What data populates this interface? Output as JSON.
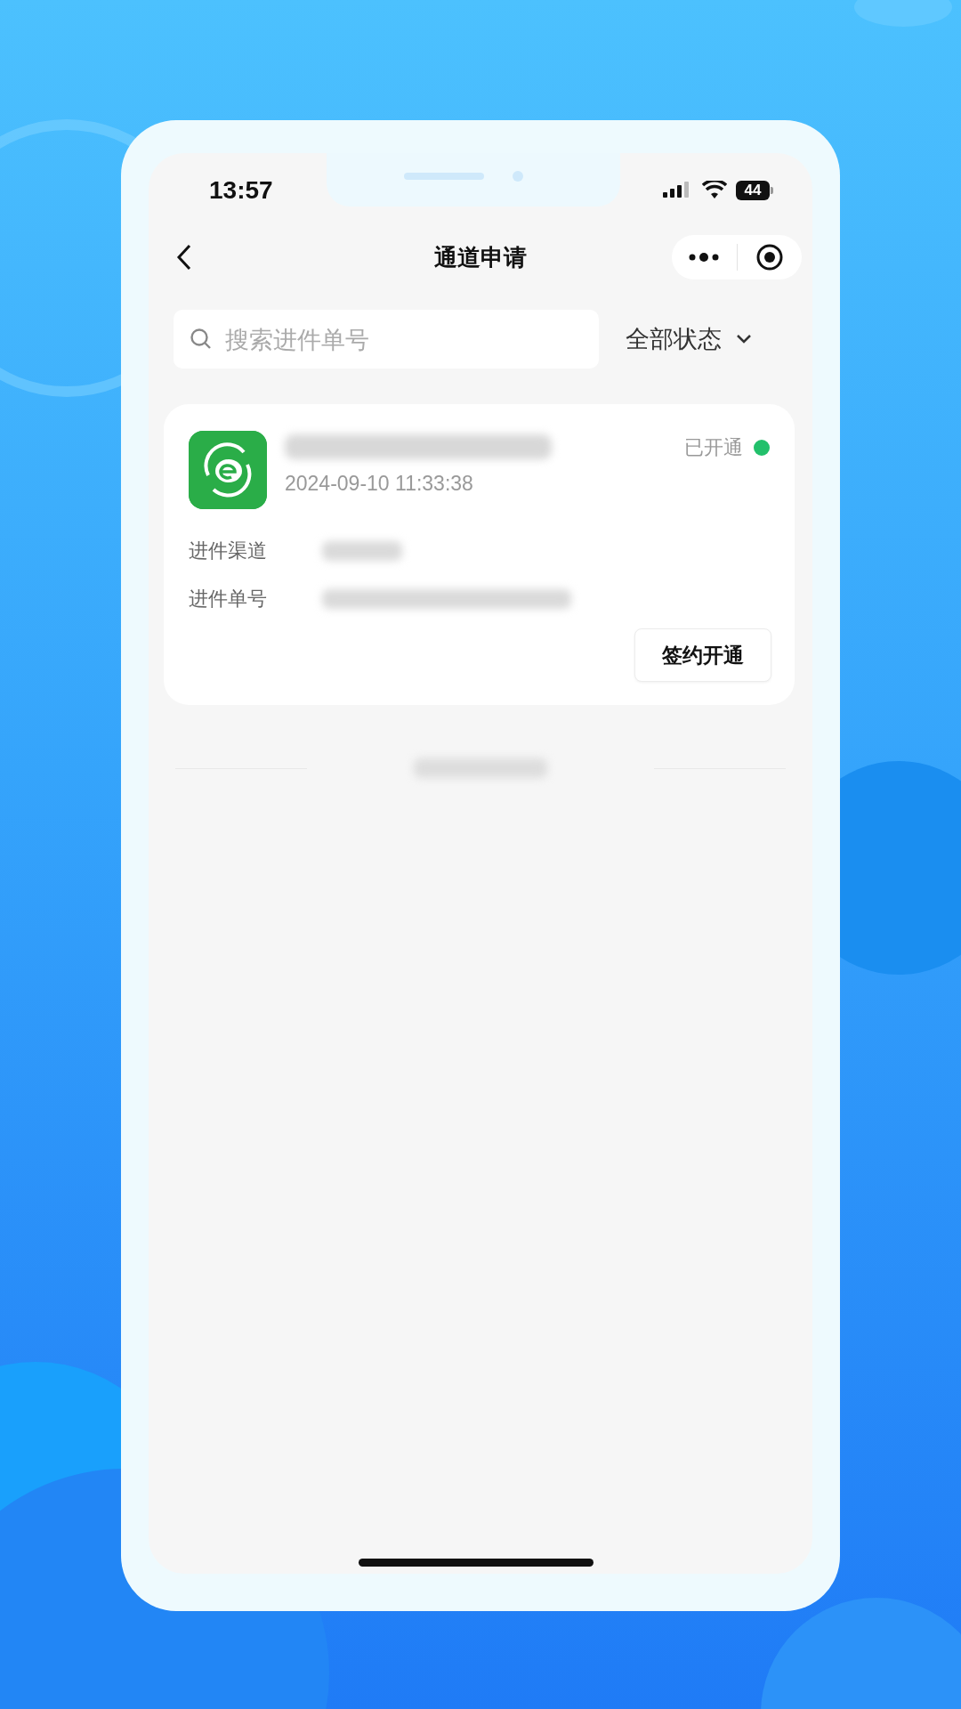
{
  "status_bar": {
    "time": "13:57",
    "battery": "44"
  },
  "nav": {
    "title": "通道申请"
  },
  "search": {
    "placeholder": "搜索进件单号"
  },
  "filter": {
    "label": "全部状态"
  },
  "records": [
    {
      "date": "2024-09-10 11:33:38",
      "status": "已开通",
      "color": "#22c06b",
      "fields": [
        {
          "label": "进件渠道"
        },
        {
          "label": "进件单号"
        }
      ],
      "action": "签约开通"
    }
  ]
}
